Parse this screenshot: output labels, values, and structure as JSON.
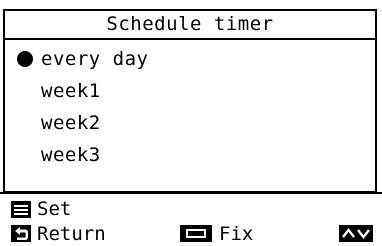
{
  "screen": {
    "title": "Schedule timer",
    "options": [
      {
        "label": "every day",
        "selected": true
      },
      {
        "label": "week1",
        "selected": false
      },
      {
        "label": "week2",
        "selected": false
      },
      {
        "label": "week3",
        "selected": false
      }
    ]
  },
  "footer": {
    "menu_icon": "menu-icon",
    "menu_label": "Set",
    "return_icon": "return-arrow-icon",
    "return_label": "Return",
    "fix_icon": "enter-button-icon",
    "fix_label": "Fix",
    "navigate_icon": "up-down-arrows-icon"
  }
}
